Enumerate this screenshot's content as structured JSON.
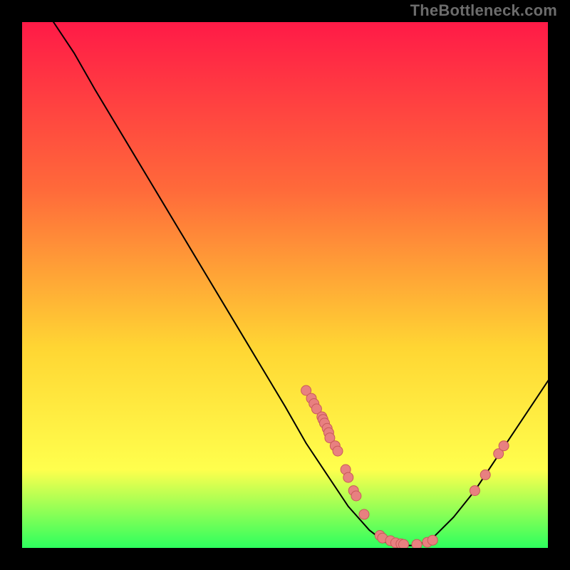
{
  "watermark": "TheBottleneck.com",
  "colors": {
    "gradient_top": "#ff1a47",
    "gradient_mid1": "#ff6a3a",
    "gradient_mid2": "#ffd633",
    "gradient_mid3": "#ffff4d",
    "gradient_bottom": "#2bff5e",
    "curve": "#000000",
    "dot_fill": "#e88080",
    "dot_stroke": "#c85a5a",
    "frame": "#000000"
  },
  "chart_data": {
    "type": "line",
    "title": "",
    "xlabel": "",
    "ylabel": "",
    "xlim": [
      0,
      100
    ],
    "ylim": [
      0,
      100
    ],
    "curve": [
      {
        "x": 6,
        "y": 100
      },
      {
        "x": 10,
        "y": 94
      },
      {
        "x": 14,
        "y": 87
      },
      {
        "x": 20,
        "y": 77
      },
      {
        "x": 26,
        "y": 67
      },
      {
        "x": 32,
        "y": 57
      },
      {
        "x": 38,
        "y": 47
      },
      {
        "x": 44,
        "y": 37
      },
      {
        "x": 50,
        "y": 27
      },
      {
        "x": 54,
        "y": 20
      },
      {
        "x": 58,
        "y": 14
      },
      {
        "x": 62,
        "y": 8
      },
      {
        "x": 66,
        "y": 3.5
      },
      {
        "x": 69,
        "y": 1.2
      },
      {
        "x": 72,
        "y": 0.6
      },
      {
        "x": 75,
        "y": 0.6
      },
      {
        "x": 78,
        "y": 2
      },
      {
        "x": 82,
        "y": 6
      },
      {
        "x": 86,
        "y": 11
      },
      {
        "x": 90,
        "y": 17
      },
      {
        "x": 94,
        "y": 23
      },
      {
        "x": 98,
        "y": 29
      },
      {
        "x": 100,
        "y": 32
      }
    ],
    "dots": [
      {
        "x": 54,
        "y": 30
      },
      {
        "x": 55,
        "y": 28.5
      },
      {
        "x": 55.5,
        "y": 27.5
      },
      {
        "x": 56,
        "y": 26.5
      },
      {
        "x": 57,
        "y": 25
      },
      {
        "x": 57.2,
        "y": 24.5
      },
      {
        "x": 57.5,
        "y": 23.8
      },
      {
        "x": 58,
        "y": 22.8
      },
      {
        "x": 58.3,
        "y": 22
      },
      {
        "x": 58.5,
        "y": 21
      },
      {
        "x": 59.5,
        "y": 19.5
      },
      {
        "x": 60,
        "y": 18.5
      },
      {
        "x": 61.5,
        "y": 15
      },
      {
        "x": 62,
        "y": 13.5
      },
      {
        "x": 63,
        "y": 11
      },
      {
        "x": 63.5,
        "y": 10
      },
      {
        "x": 65,
        "y": 6.5
      },
      {
        "x": 68,
        "y": 2.5
      },
      {
        "x": 68.5,
        "y": 2
      },
      {
        "x": 70,
        "y": 1.5
      },
      {
        "x": 71,
        "y": 1.1
      },
      {
        "x": 72,
        "y": 0.9
      },
      {
        "x": 72.5,
        "y": 0.8
      },
      {
        "x": 75,
        "y": 0.8
      },
      {
        "x": 77,
        "y": 1.2
      },
      {
        "x": 78,
        "y": 1.6
      },
      {
        "x": 86,
        "y": 11
      },
      {
        "x": 88,
        "y": 14
      },
      {
        "x": 90.5,
        "y": 18
      },
      {
        "x": 91.5,
        "y": 19.5
      }
    ]
  }
}
